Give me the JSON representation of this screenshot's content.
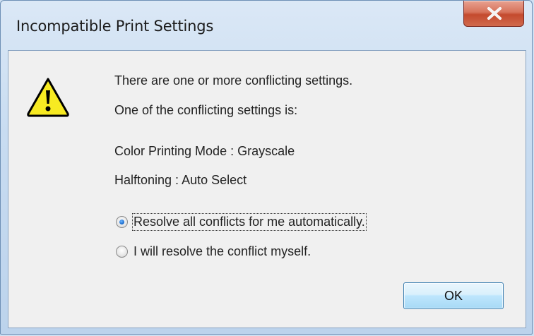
{
  "window": {
    "title": "Incompatible Print Settings",
    "close_label": "X"
  },
  "message": {
    "line1": "There are one or more conflicting settings.",
    "line2": "One of the conflicting settings is:",
    "setting1": "Color Printing Mode : Grayscale",
    "setting2": "Halftoning : Auto Select"
  },
  "options": [
    {
      "label": "Resolve all conflicts for me automatically.",
      "checked": true
    },
    {
      "label": "I will resolve the conflict myself.",
      "checked": false
    }
  ],
  "buttons": {
    "ok_label": "OK"
  },
  "icons": {
    "warning": "warning-icon",
    "close": "close-icon"
  },
  "colors": {
    "close_button": "#c94f33",
    "warning_yellow": "#f5e61a",
    "ok_button": "#bfe5fb"
  }
}
